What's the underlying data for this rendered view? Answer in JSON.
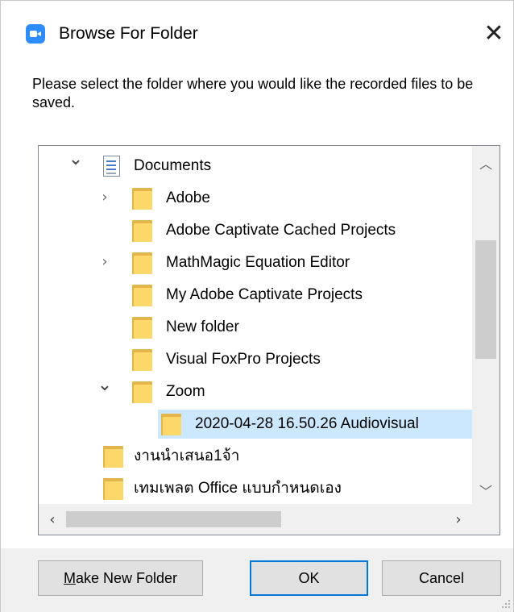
{
  "dialog": {
    "title": "Browse For Folder",
    "close_glyph": "✕",
    "prompt": "Please select the folder where you would like the recorded files to be saved."
  },
  "tree": {
    "items": [
      {
        "label": "Documents",
        "expander": "expanded",
        "icon": "document-icon"
      },
      {
        "label": "Adobe",
        "expander": "collapsed",
        "icon": "folder-icon"
      },
      {
        "label": "Adobe Captivate Cached Projects",
        "expander": "none",
        "icon": "folder-icon"
      },
      {
        "label": "MathMagic Equation Editor",
        "expander": "collapsed",
        "icon": "folder-icon"
      },
      {
        "label": "My Adobe Captivate Projects",
        "expander": "none",
        "icon": "folder-icon"
      },
      {
        "label": "New folder",
        "expander": "none",
        "icon": "folder-icon"
      },
      {
        "label": "Visual FoxPro Projects",
        "expander": "none",
        "icon": "folder-icon"
      },
      {
        "label": "Zoom",
        "expander": "expanded",
        "icon": "folder-icon"
      },
      {
        "label": "2020-04-28 16.50.26 Audiovisual",
        "expander": "none",
        "icon": "folder-icon",
        "selected": true
      },
      {
        "label": "งานนำเสนอ1จ้า",
        "expander": "none",
        "icon": "folder-icon"
      },
      {
        "label": "เทมเพลต Office แบบกำหนดเอง",
        "expander": "none",
        "icon": "folder-icon"
      }
    ],
    "selected_color": "#cce8ff"
  },
  "buttons": {
    "make_new_folder_mnemonic": "M",
    "make_new_folder_rest": "ake New Folder",
    "ok": "OK",
    "cancel": "Cancel"
  },
  "colors": {
    "accent": "#0078d7",
    "app_icon": "#2d8cff",
    "folder": "#fcd86b"
  }
}
